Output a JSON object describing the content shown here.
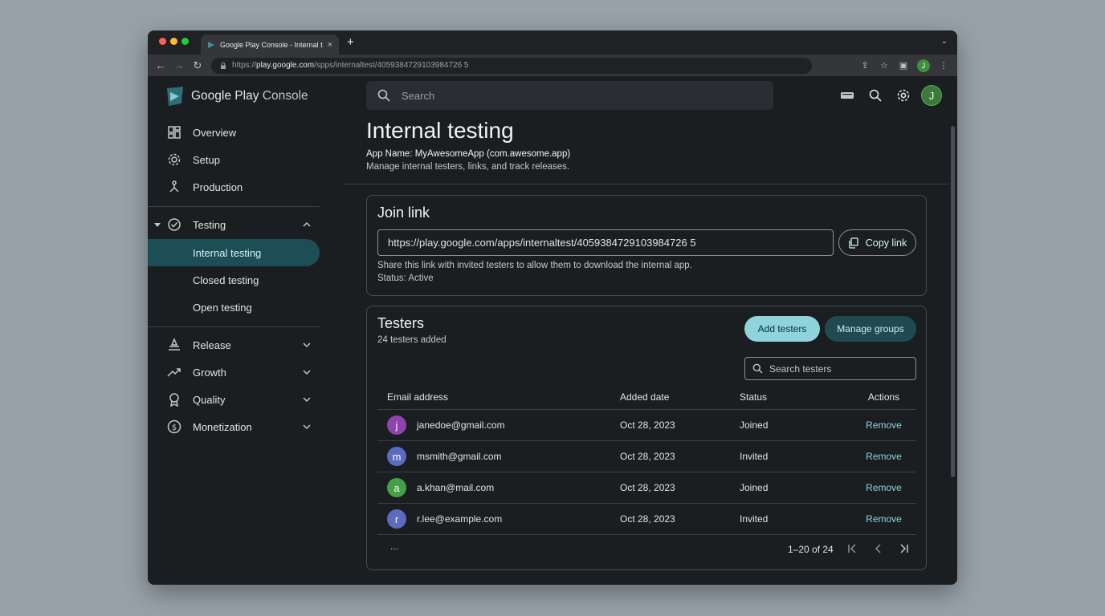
{
  "browser": {
    "tab_title": "Google Play Console - Internal t",
    "url_prefix": "https://",
    "url_host": "play.google.com",
    "url_path": "/spps/internaltest/4059384729103984726 5",
    "profile_initial": "J"
  },
  "brand": {
    "name_google_play": "Google Play",
    "name_console": "Console"
  },
  "sidebar": {
    "items": [
      {
        "label": "Overview",
        "icon": "dashboard-icon"
      },
      {
        "label": "Setup",
        "icon": "gear-icon"
      },
      {
        "label": "Production",
        "icon": "production-icon"
      },
      {
        "label": "Testing",
        "icon": "check-circle-icon"
      },
      {
        "label": "Internal testing"
      },
      {
        "label": "Closed testing"
      },
      {
        "label": "Open testing"
      },
      {
        "label": "Release",
        "icon": "release-icon"
      },
      {
        "label": "Growth",
        "icon": "trending-up-icon"
      },
      {
        "label": "Quality",
        "icon": "badge-icon"
      },
      {
        "label": "Monetization",
        "icon": "dollar-icon"
      }
    ]
  },
  "header": {
    "search_placeholder": "Search",
    "avatar_initial": "J"
  },
  "page": {
    "title": "Internal testing",
    "app_name": "App Name: MyAwesomeApp (com.awesome.app)",
    "subtitle": "Manage internal testers, links, and track releases."
  },
  "join_link": {
    "title": "Join link",
    "url": "https://play.google.com/apps/internaltest/4059384729103984726 5",
    "copy_label": "Copy link",
    "note": "Share this link with invited testers to allow them to download the internal app.",
    "status": "Status: Active"
  },
  "testers": {
    "title": "Testers",
    "count": "24 testers added",
    "add_label": "Add testers",
    "groups_label": "Manage groups",
    "search_placeholder": "Search testers",
    "columns": [
      "Email address",
      "Added date",
      "Status",
      "Actions"
    ],
    "rows": [
      {
        "initial": "j",
        "email": "janedoe@gmail.com",
        "date": "Oct 28, 2023",
        "status": "Joined",
        "action": "Remove",
        "color": "#8e44ad"
      },
      {
        "initial": "m",
        "email": "msmith@gmail.com",
        "date": "Oct 28, 2023",
        "status": "Invited",
        "action": "Remove",
        "color": "#5c6bc0"
      },
      {
        "initial": "a",
        "email": "a.khan@mail.com",
        "date": "Oct 28, 2023",
        "status": "Joined",
        "action": "Remove",
        "color": "#43a047"
      },
      {
        "initial": "r",
        "email": "r.lee@example.com",
        "date": "Oct 28, 2023",
        "status": "Invited",
        "action": "Remove",
        "color": "#5c6bc0"
      }
    ],
    "ellipsis": "...",
    "page_range": "1–20 of 24"
  },
  "colors": {
    "accent": "#8fd3dc",
    "active_nav": "#1d4d55",
    "background": "#1b1e21"
  }
}
